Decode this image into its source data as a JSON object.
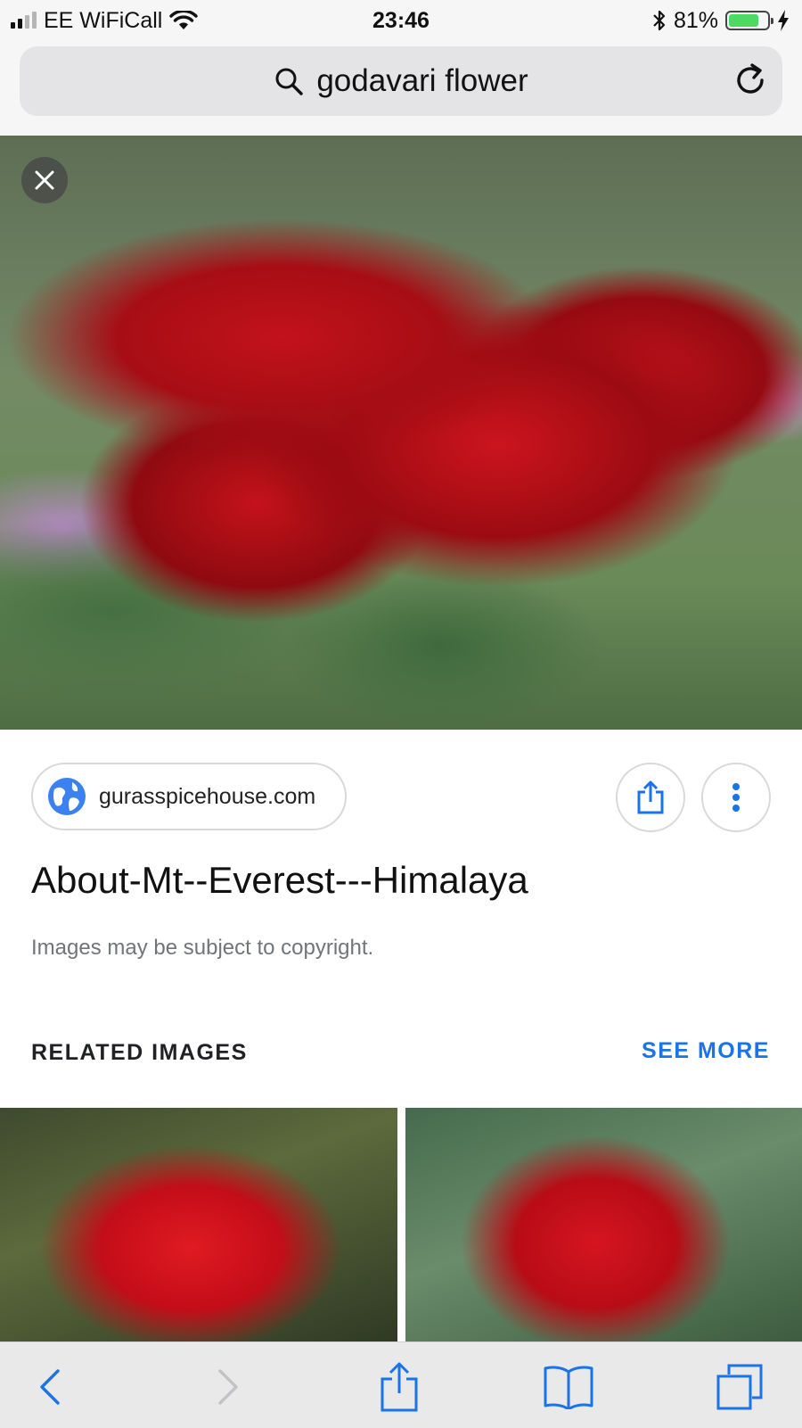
{
  "status_bar": {
    "carrier": "EE WiFiCall",
    "time": "23:46",
    "battery_percent": "81%",
    "battery_level": 0.81
  },
  "url_bar": {
    "query": "godavari flower"
  },
  "result": {
    "source": "gurasspicehouse.com",
    "title": "About-Mt--Everest---Himalaya",
    "copyright_notice": "Images may be subject to copyright."
  },
  "related": {
    "label": "RELATED IMAGES",
    "see_more": "SEE MORE"
  },
  "colors": {
    "accent": "#1a73e8",
    "battery": "#4cd964"
  },
  "icons": [
    "signal-icon",
    "wifi-icon",
    "bluetooth-icon",
    "battery-icon",
    "charging-icon",
    "search-icon",
    "reload-icon",
    "close-icon",
    "globe-icon",
    "share-icon",
    "more-vertical-icon",
    "back-icon",
    "forward-icon",
    "bookmarks-icon",
    "tabs-icon"
  ]
}
